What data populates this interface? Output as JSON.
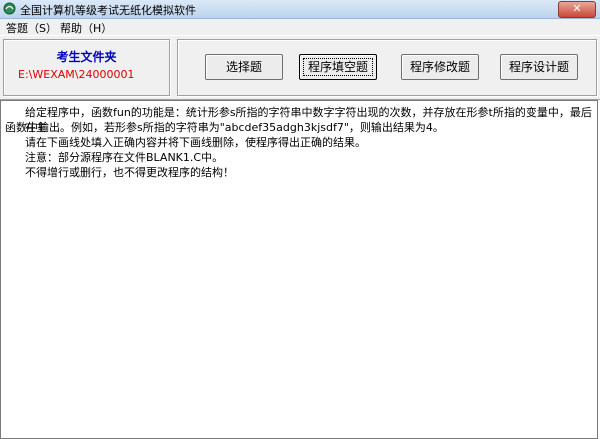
{
  "window": {
    "title": "全国计算机等级考试无纸化模拟软件"
  },
  "menu": [
    {
      "label": "答题（S）"
    },
    {
      "label": "帮助（H）"
    }
  ],
  "folder": {
    "title": "考生文件夹",
    "path": "E:\\WEXAM\\24000001"
  },
  "question_tabs": [
    {
      "label": "选择题"
    },
    {
      "label": "程序填空题"
    },
    {
      "label": "程序修改题"
    },
    {
      "label": "程序设计题"
    }
  ],
  "active_tab": "程序填空题",
  "content": {
    "lines": [
      "给定程序中，函数fun的功能是：统计形参s所指的字符串中数字字符出现的次数，并存放在形参t所指的变量中，最后在主",
      "函数中输出。例如，若形参s所指的字符串为\"abcdef35adgh3kjsdf7\"，则输出结果为4。",
      "请在下画线处填入正确内容并将下画线删除，使程序得出正确的结果。",
      "注意：部分源程序在文件BLANK1.C中。",
      "不得增行或删行，也不得更改程序的结构！"
    ]
  }
}
